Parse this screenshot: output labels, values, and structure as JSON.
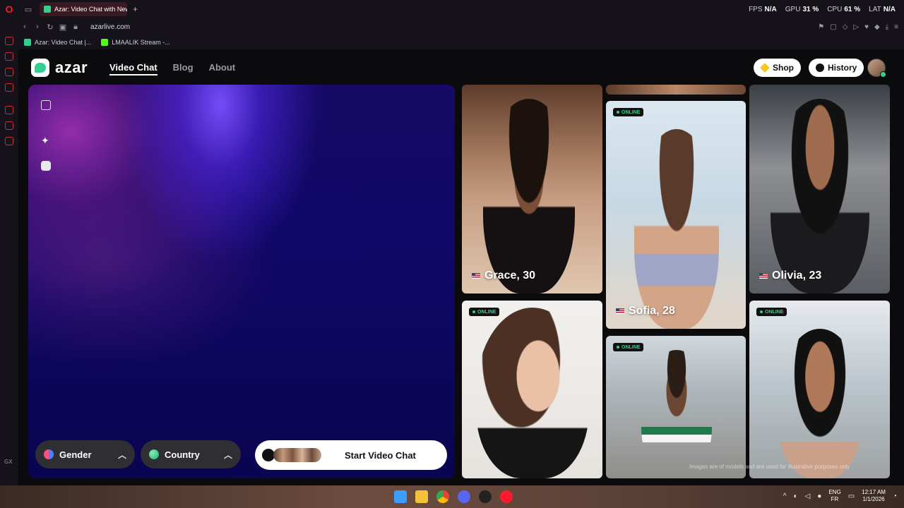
{
  "browser": {
    "tab_title": "Azar: Video Chat with New",
    "url": "azarlive.com",
    "new_tab_symbol": "+",
    "stats": [
      {
        "label": "FPS",
        "value": "N/A"
      },
      {
        "label": "GPU",
        "value": "31 %"
      },
      {
        "label": "CPU",
        "value": "61 %"
      },
      {
        "label": "LAT",
        "value": "N/A"
      }
    ],
    "bookmarks": [
      {
        "label": "Azar: Video Chat |...",
        "color": "#31d18d"
      },
      {
        "label": "LMAALIK Stream -...",
        "color": "#53fc18"
      }
    ],
    "sidebar_label": "GX"
  },
  "site": {
    "logo": "azar",
    "nav": {
      "video_chat": "Video Chat",
      "blog": "Blog",
      "about": "About"
    },
    "shop_label": "Shop",
    "history_label": "History"
  },
  "controls": {
    "gender_label": "Gender",
    "country_label": "Country",
    "start_label": "Start Video Chat",
    "chevron": "^"
  },
  "gallery": {
    "online_badge": "ONLINE",
    "profiles": [
      {
        "name": "Grace, 30",
        "online": false
      },
      {
        "name": "Sofia, 28",
        "online": true
      },
      {
        "name": "Olivia, 23",
        "online": false
      },
      {
        "name": "",
        "online": true
      },
      {
        "name": "",
        "online": true
      },
      {
        "name": "",
        "online": true
      }
    ],
    "disclaimer": "Images are of models and are used for illustrative purposes only"
  },
  "taskbar": {
    "lang_top": "ENG",
    "lang_bottom": "FR",
    "time": "12:17 AM",
    "date": "1/1/2026"
  },
  "colors": {
    "brand_green": "#31d18d",
    "opera_red": "#ff1b2d"
  }
}
